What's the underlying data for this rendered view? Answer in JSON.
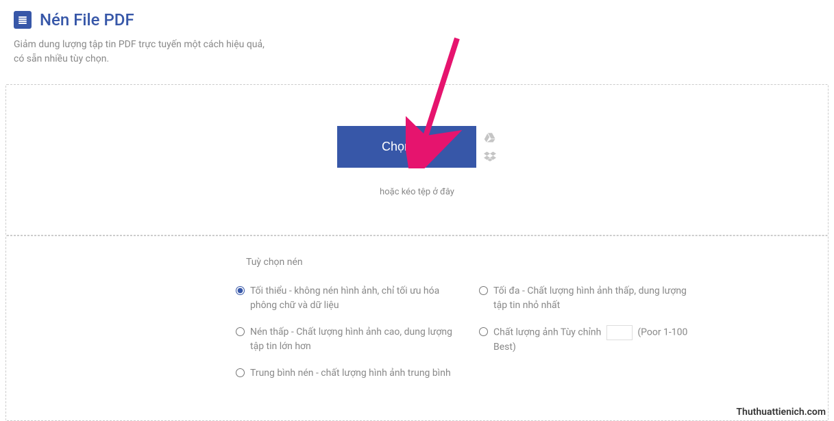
{
  "header": {
    "title": "Nén File PDF",
    "subtitle_line1": "Giảm dung lượng tập tin PDF trực tuyến một cách hiệu quả,",
    "subtitle_line2": "có sẵn nhiều tùy chọn."
  },
  "upload": {
    "button_label": "Chọn tệp",
    "drop_text": "hoặc kéo tệp ở đây"
  },
  "options": {
    "title": "Tuỳ chọn nén",
    "items": [
      "Tối thiểu - không nén hình ảnh, chỉ tối ưu hóa phông chữ và dữ liệu",
      "Nén thấp - Chất lượng hình ảnh cao, dung lượng tập tin lớn hơn",
      "Trung bình nén - chất lượng hình ảnh trung bình",
      "Tối đa - Chất lượng hình ảnh thấp, dung lượng tập tin nhỏ nhất"
    ],
    "custom_prefix": "Chất lượng ảnh Tùy chỉnh",
    "custom_suffix": "(Poor 1-100 Best)"
  },
  "watermark": "Thuthuattienich.com"
}
